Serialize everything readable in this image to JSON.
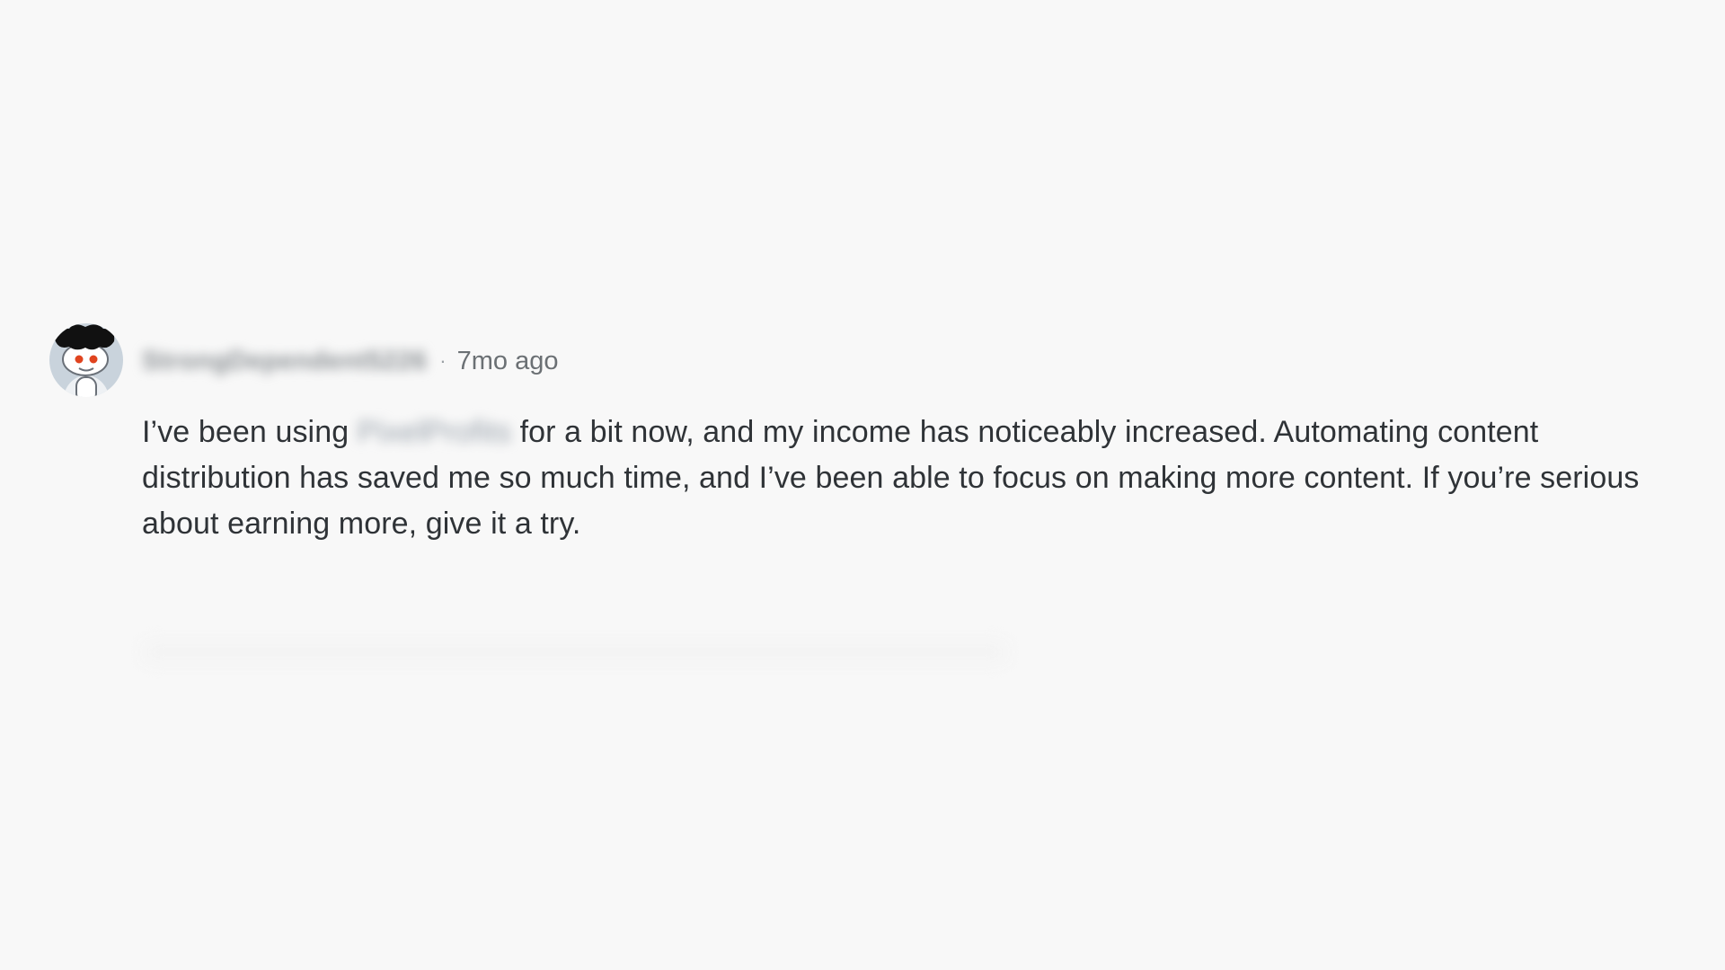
{
  "comment": {
    "username": "StrongDependent5226",
    "separator": "·",
    "timestamp": "7mo ago",
    "body_before": "I’ve been using ",
    "product_name": "PixelProfits",
    "body_after": " for a bit now, and my income has noticeably increased. Automating content distribution has saved me so much time, and I’ve been able to focus on making more content. If you’re serious about earning more, give it a try."
  },
  "avatar": {
    "icon": "reddit-snoo-avatar-icon",
    "hair_color": "#111111",
    "eye_color": "#e0441f",
    "background_color": "#c9d3dc"
  },
  "colors": {
    "page_background": "#f8f8f8",
    "body_text": "#2f3337",
    "meta_text": "#6b7074"
  }
}
